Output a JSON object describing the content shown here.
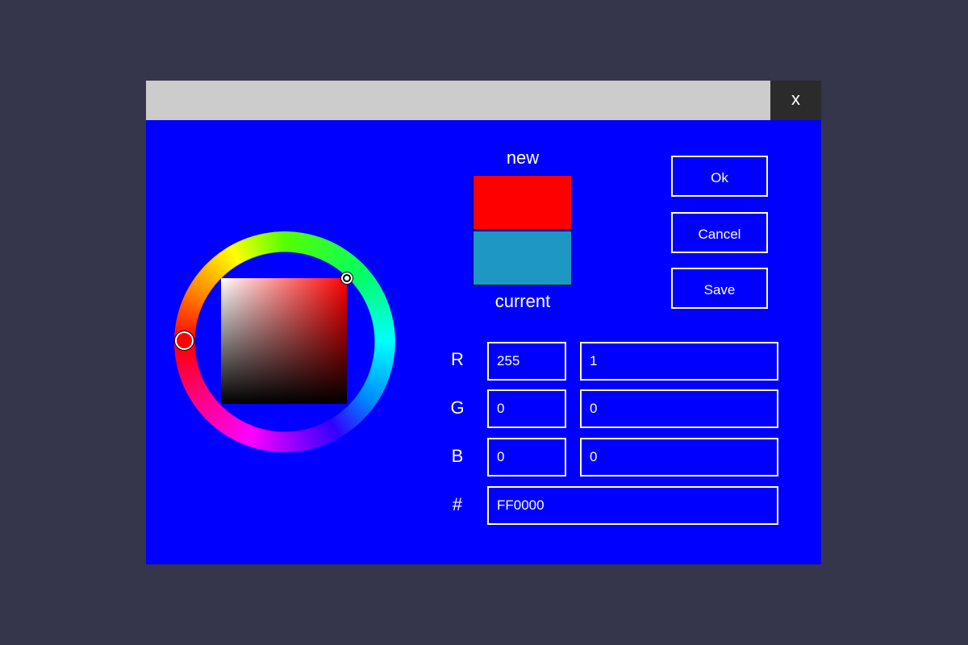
{
  "titlebar": {
    "close_label": "x"
  },
  "preview": {
    "new_label": "new",
    "current_label": "current",
    "new_color": "#ff0000",
    "current_color": "#1e97c4"
  },
  "buttons": {
    "ok_label": "Ok",
    "cancel_label": "Cancel",
    "save_label": "Save"
  },
  "wheel": {
    "hue_degrees": 0,
    "selected_color": "#ff0000"
  },
  "channels": [
    {
      "label": "R",
      "value": "255",
      "fraction": "1"
    },
    {
      "label": "G",
      "value": "0",
      "fraction": "0"
    },
    {
      "label": "B",
      "value": "0",
      "fraction": "0"
    }
  ],
  "hex": {
    "label": "#",
    "value": "FF0000"
  },
  "colors": {
    "backdrop": "#35354b",
    "panel": "#0000ff",
    "titlebar": "#cccccc",
    "close_bg": "#2b2b2b"
  }
}
